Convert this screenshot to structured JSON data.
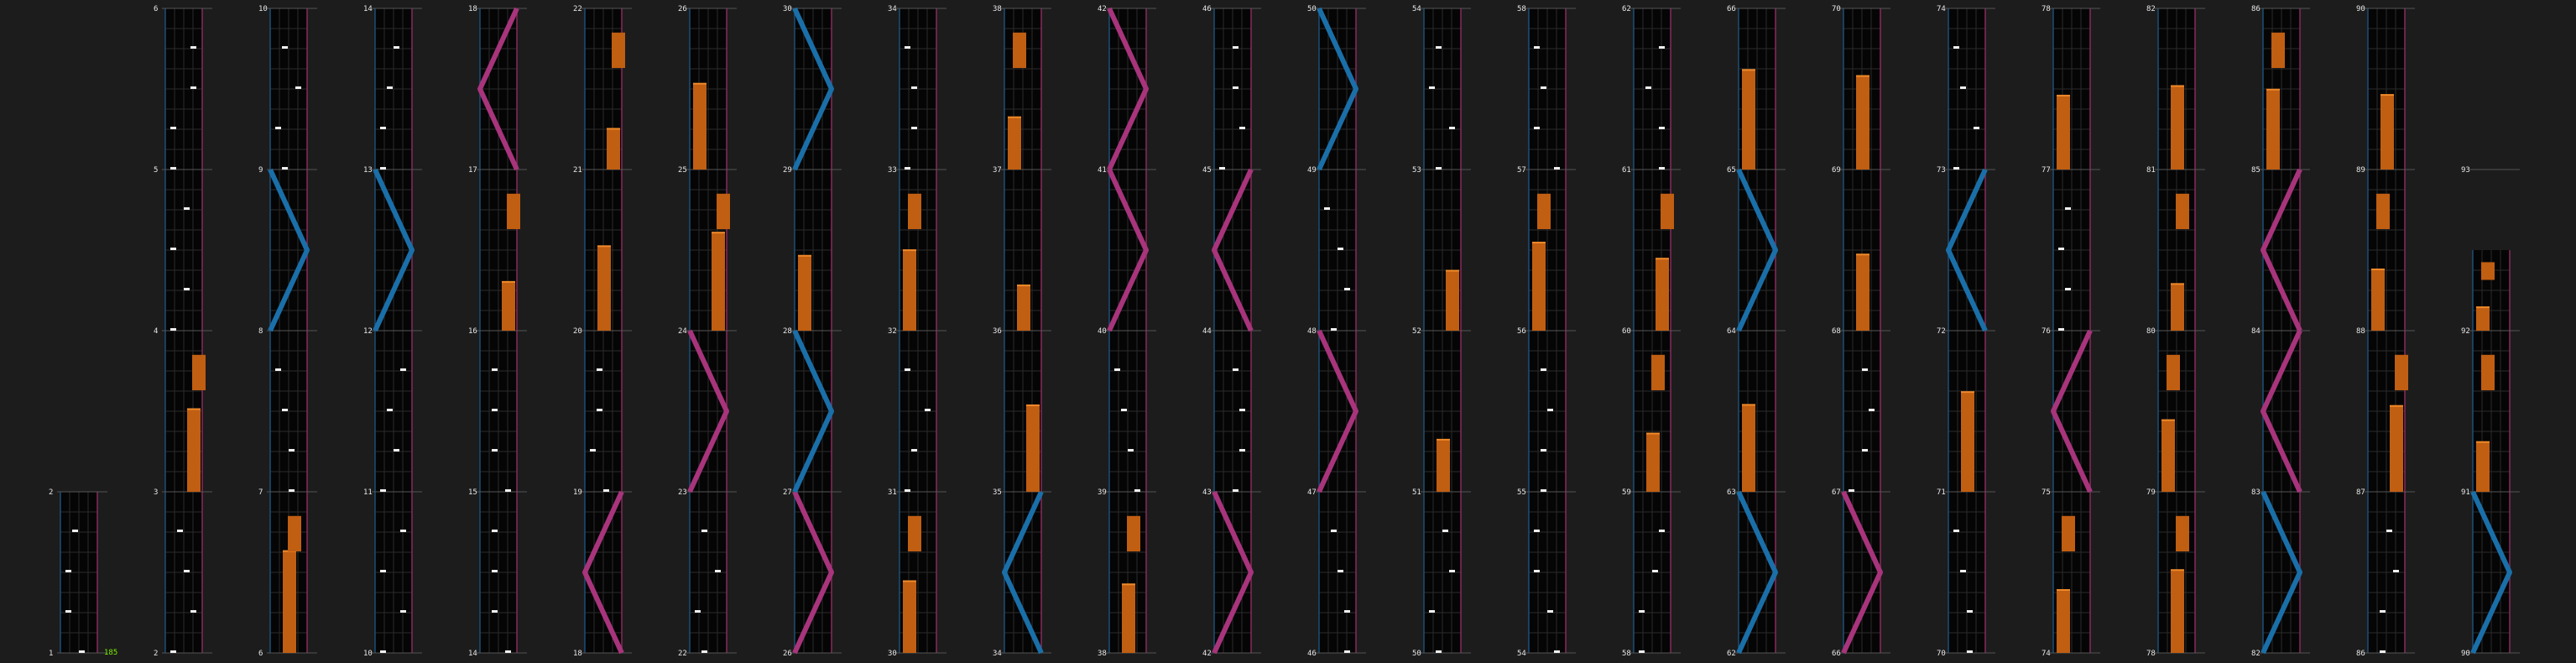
{
  "chart_data": {
    "type": "lane-chart",
    "colors": {
      "background": "#1c1c1c",
      "lane_bg": "#050505",
      "grid": "#2a2a2a",
      "measure_line": "#555555",
      "left_border": "#1b4f78",
      "right_border": "#8a2a5c",
      "hold": "#c05e12",
      "hold_edge": "#f08a2a",
      "note": "#f0f0f0",
      "blue": "#1a6fa8",
      "pink": "#a8347c",
      "count": "#7cf000"
    },
    "status": {
      "count": "185"
    },
    "columns": [
      {
        "measures": [
          1,
          2
        ],
        "filled": 1
      },
      {
        "measures": [
          2,
          3,
          4,
          5,
          6
        ]
      },
      {
        "measures": [
          6,
          7,
          8,
          9,
          10
        ]
      },
      {
        "measures": [
          10,
          11,
          12,
          13,
          14
        ]
      },
      {
        "measures": [
          14,
          15,
          16,
          17,
          18
        ]
      },
      {
        "measures": [
          18,
          19,
          20,
          21,
          22
        ]
      },
      {
        "measures": [
          22,
          23,
          24,
          25,
          26
        ]
      },
      {
        "measures": [
          26,
          27,
          28,
          29,
          30
        ]
      },
      {
        "measures": [
          30,
          31,
          32,
          33,
          34
        ]
      },
      {
        "measures": [
          34,
          35,
          36,
          37,
          38
        ]
      },
      {
        "measures": [
          38,
          39,
          40,
          41,
          42
        ]
      },
      {
        "measures": [
          42,
          43,
          44,
          45,
          46
        ]
      },
      {
        "measures": [
          46,
          47,
          48,
          49,
          50
        ]
      },
      {
        "measures": [
          50,
          51,
          52,
          53,
          54
        ]
      },
      {
        "measures": [
          54,
          55,
          56,
          57,
          58
        ]
      },
      {
        "measures": [
          58,
          59,
          60,
          61,
          62
        ]
      },
      {
        "measures": [
          62,
          63,
          64,
          65,
          66
        ]
      },
      {
        "measures": [
          66,
          67,
          68,
          69,
          70
        ]
      },
      {
        "measures": [
          70,
          71,
          72,
          73,
          74
        ]
      },
      {
        "measures": [
          74,
          75,
          76,
          77,
          78
        ]
      },
      {
        "measures": [
          78,
          79,
          80,
          81,
          82
        ]
      },
      {
        "measures": [
          82,
          83,
          84,
          85,
          86
        ]
      },
      {
        "measures": [
          86,
          87,
          88,
          89,
          90
        ]
      },
      {
        "measures": [
          90,
          91,
          92,
          93
        ],
        "filled": 2.5
      }
    ]
  }
}
